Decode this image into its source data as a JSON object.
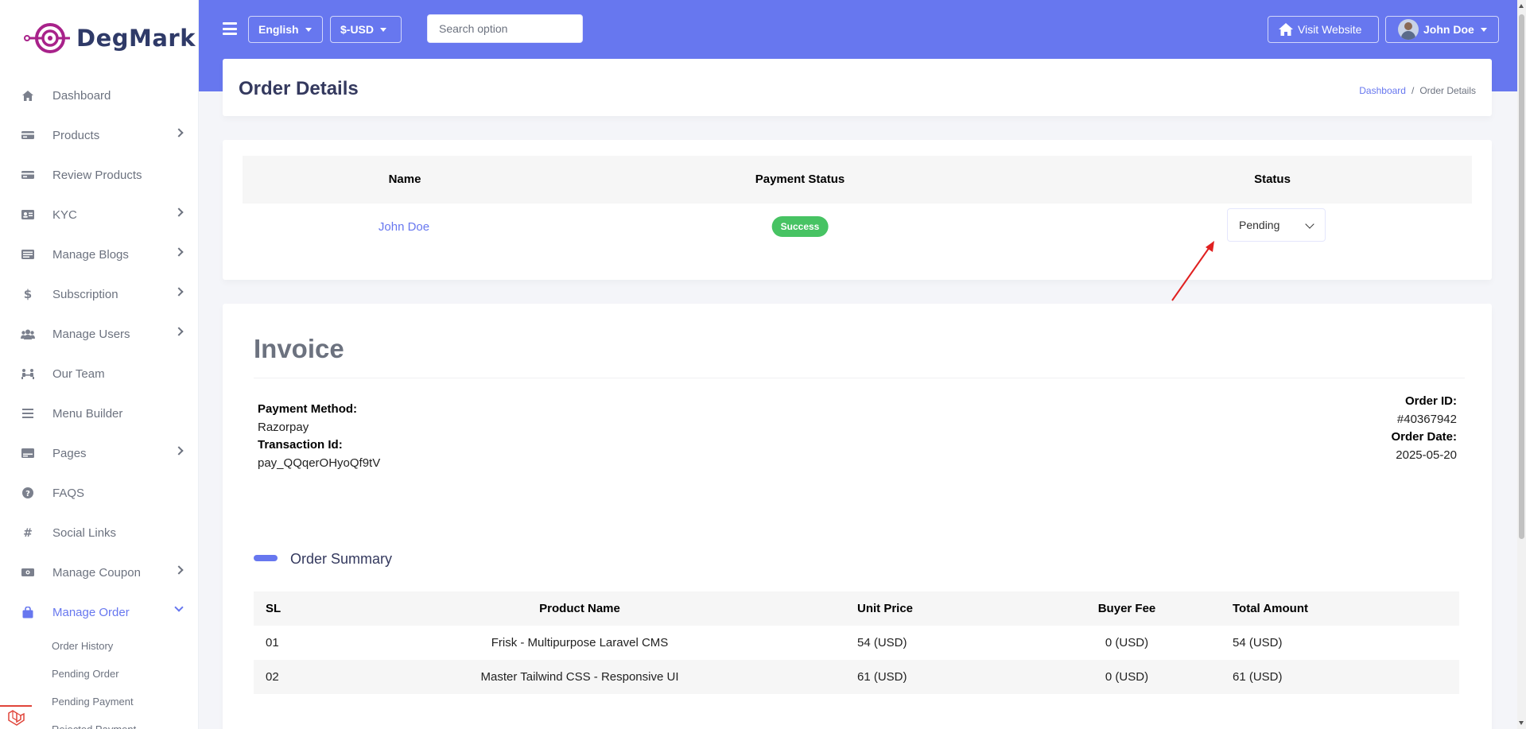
{
  "app": {
    "name": "DegMark"
  },
  "sidebar": {
    "items": [
      {
        "label": "Dashboard",
        "icon": "home-icon",
        "has_submenu": false
      },
      {
        "label": "Products",
        "icon": "card-icon",
        "has_submenu": true
      },
      {
        "label": "Review Products",
        "icon": "card-icon",
        "has_submenu": false
      },
      {
        "label": "KYC",
        "icon": "id-card-icon",
        "has_submenu": true
      },
      {
        "label": "Manage Blogs",
        "icon": "blog-icon",
        "has_submenu": true
      },
      {
        "label": "Subscription",
        "icon": "dollar-icon",
        "has_submenu": true
      },
      {
        "label": "Manage Users",
        "icon": "users-icon",
        "has_submenu": true
      },
      {
        "label": "Our Team",
        "icon": "team-icon",
        "has_submenu": false
      },
      {
        "label": "Menu Builder",
        "icon": "bars-icon",
        "has_submenu": false
      },
      {
        "label": "Pages",
        "icon": "pages-icon",
        "has_submenu": true
      },
      {
        "label": "FAQS",
        "icon": "question-circle-icon",
        "has_submenu": false
      },
      {
        "label": "Social Links",
        "icon": "hashtag-icon",
        "has_submenu": false
      },
      {
        "label": "Manage Coupon",
        "icon": "coupon-icon",
        "has_submenu": true
      },
      {
        "label": "Manage Order",
        "icon": "shopping-bag-icon",
        "has_submenu": true,
        "active": true
      }
    ],
    "order_submenu": [
      "Order History",
      "Pending Order",
      "Pending Payment",
      "Rejected Payment"
    ]
  },
  "header": {
    "language": "English",
    "currency": "$-USD",
    "search_placeholder": "Search option",
    "visit_website": "Visit Website",
    "user_name": "John Doe"
  },
  "page": {
    "title": "Order Details",
    "breadcrumb": [
      "Dashboard",
      "Order Details"
    ]
  },
  "order": {
    "headers": {
      "name": "Name",
      "payment_status": "Payment Status",
      "status": "Status"
    },
    "customer_name": "John Doe",
    "payment_status": "Success",
    "status": "Pending"
  },
  "invoice": {
    "title": "Invoice",
    "payment_method_label": "Payment Method:",
    "payment_method": "Razorpay",
    "transaction_label": "Transaction Id:",
    "transaction_id": "pay_QQqerOHyoQf9tV",
    "order_id_label": "Order ID:",
    "order_id": "#40367942",
    "order_date_label": "Order Date:",
    "order_date": "2025-05-20",
    "summary_title": "Order Summary",
    "columns": [
      "SL",
      "Product Name",
      "Unit Price",
      "Buyer Fee",
      "Total Amount"
    ],
    "rows": [
      {
        "sl": "01",
        "product": "Frisk - Multipurpose Laravel CMS",
        "unit_price": "54 (USD)",
        "buyer_fee": "0 (USD)",
        "total": "54 (USD)"
      },
      {
        "sl": "02",
        "product": "Master Tailwind CSS - Responsive UI",
        "unit_price": "61 (USD)",
        "buyer_fee": "0 (USD)",
        "total": "61 (USD)"
      }
    ]
  },
  "colors": {
    "primary": "#6777ef",
    "success": "#47c363",
    "annotation_arrow": "#e02020"
  }
}
